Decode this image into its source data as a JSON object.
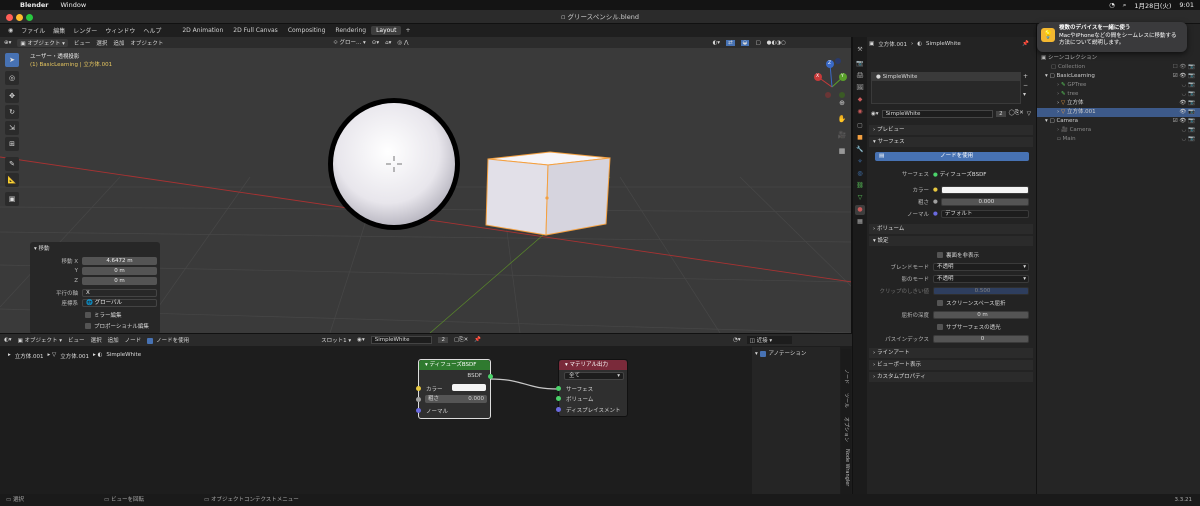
{
  "mac_menu": {
    "app": "Blender",
    "window": "Window",
    "date": "1月28日(火)",
    "time": "9:01"
  },
  "title": "グリースペンシル.blend",
  "menus": [
    "ファイル",
    "編集",
    "レンダー",
    "ウィンドウ",
    "ヘルプ"
  ],
  "workspaces": [
    {
      "label": "2D Animation"
    },
    {
      "label": "2D Full Canvas"
    },
    {
      "label": "Compositing"
    },
    {
      "label": "Rendering"
    },
    {
      "label": "Layout",
      "active": true
    }
  ],
  "add_tab": "+",
  "viewport": {
    "mode": "オブジェクト",
    "header_menus": [
      "ビュー",
      "選択",
      "追加",
      "オブジェクト"
    ],
    "transform": "グロー...",
    "overlay_title": "ユーザー・透視投影",
    "overlay_sub": "(1) BasicLearning | 立方体.001",
    "gizmo": {
      "x": "X",
      "y": "Y",
      "z": "Z"
    }
  },
  "op_panel": {
    "title": "移動",
    "rows": [
      {
        "label": "移動 X",
        "value": "4.6472 m"
      },
      {
        "label": "Y",
        "value": "0 m"
      },
      {
        "label": "Z",
        "value": "0 m"
      }
    ],
    "axis_label": "平行の軸",
    "axis_value": "X",
    "orient_label": "座標系",
    "orient_value": "グローバル",
    "mirror": "ミラー編集",
    "proportional": "プロポーショナル編集"
  },
  "node_editor": {
    "mode": "オブジェクト",
    "menus": [
      "ビュー",
      "選択",
      "追加",
      "ノード"
    ],
    "use_nodes": "ノードを使用",
    "slot": "スロット1",
    "material": "SimpleWhite",
    "users": "2",
    "breadcrumb": [
      "立方体.001",
      "立方体.001",
      "SimpleWhite"
    ],
    "diffuse": {
      "title": "ディフューズBSDF",
      "out": "BSDF",
      "color": "カラー",
      "rough": "粗さ",
      "rough_val": "0.000",
      "normal": "ノーマル"
    },
    "output": {
      "title": "マテリアル出力",
      "target": "全て",
      "surface": "サーフェス",
      "volume": "ボリューム",
      "disp": "ディスプレイスメント"
    },
    "side_dropdown": "近接",
    "side_annotation": "アノテーション",
    "side_tabs": [
      "ノード",
      "ツール",
      "オプション",
      "Node Wrangler"
    ]
  },
  "properties": {
    "object": "立方体.001",
    "material": "SimpleWhite",
    "slot_item": "SimpleWhite",
    "mat_name": "SimpleWhite",
    "users": "2",
    "sections": {
      "preview": "プレビュー",
      "surface": "サーフェス",
      "volume": "ボリューム",
      "settings": "設定",
      "lineart": "ラインアート",
      "viewport": "ビューポート表示",
      "custom": "カスタムプロパティ"
    },
    "use_nodes": "ノードを使用",
    "surface_label": "サーフェス",
    "surface_value": "ディフューズBSDF",
    "color_label": "カラー",
    "rough_label": "粗さ",
    "rough_value": "0.000",
    "normal_label": "ノーマル",
    "normal_value": "デフォルト",
    "backface": "裏面を非表示",
    "blend_label": "ブレンドモード",
    "blend_value": "不透明",
    "shadow_label": "影のモード",
    "shadow_value": "不透明",
    "clip_label": "クリップのしきい値",
    "clip_value": "0.500",
    "ssr": "スクリーンスペース屈折",
    "refr_label": "屈折の深度",
    "refr_value": "0 m",
    "sss": "サブサーフェスの透光",
    "pass_label": "パスインデックス",
    "pass_value": "0"
  },
  "outliner": {
    "root": "シーンコレクション",
    "items": [
      {
        "label": "Collection"
      },
      {
        "label": "BasicLearning"
      },
      {
        "label": "GPTree"
      },
      {
        "label": "tree"
      },
      {
        "label": "立方体"
      },
      {
        "label": "立方体.001"
      },
      {
        "label": "Camera"
      },
      {
        "label": "Camera"
      },
      {
        "label": "Main"
      }
    ]
  },
  "notification": {
    "line1": "複数のデバイスを一緒に使う",
    "line2": "MacやiPhoneなどの間をシームレスに移動する",
    "line3": "方法について説明します。"
  },
  "status": {
    "select": "選択",
    "rotate": "ビューを回転",
    "context": "オブジェクトコンテクストメニュー",
    "version": "3.3.21"
  },
  "colors": {
    "accent": "#4772b3",
    "select_orange": "#f4a040",
    "diffuse_header": "#2f7a2f",
    "output_header": "#7a2a3a"
  }
}
